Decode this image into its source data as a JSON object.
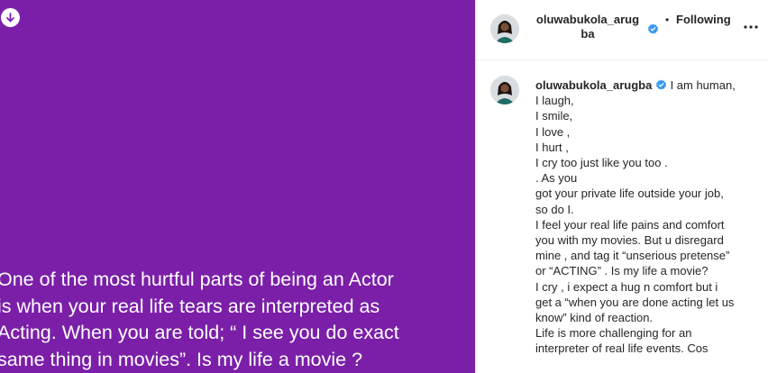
{
  "post": {
    "quote_lines": [
      "One of the most hurtful parts of being an Actor",
      "is when your real life tears are interpreted as",
      "Acting.  When you are told; “ I see you do exact",
      "same thing in movies”. Is my life a movie ?"
    ],
    "background_color": "#7b1fa8",
    "download_icon": "arrow-down-circle-icon"
  },
  "header": {
    "username_line1": "oluwabukola_arug",
    "username_line2": "ba",
    "separator": "•",
    "follow_label": "Following",
    "more_icon": "more-horizontal-icon",
    "verified_icon": "verified-badge-icon"
  },
  "caption": {
    "username": "oluwabukola_arugba",
    "first_text": "I am human,",
    "lines": [
      "I laugh,",
      "I smile,",
      "I love ,",
      "I hurt ,",
      "I cry too just like you too .",
      ". As you",
      "got your private life outside your job,",
      "so do I.",
      "I feel your real life pains and comfort",
      "you with my movies. But u disregard",
      "mine , and tag it “unserious pretense”",
      "or “ACTING” . Is my life a movie?",
      "I cry , i expect a hug n comfort but i",
      "get a “when you are done acting let us",
      "know” kind of reaction.",
      "Life is more challenging for an",
      "interpreter of real life events. Cos"
    ]
  },
  "colors": {
    "verified_blue": "#3897f0",
    "text": "#262626"
  }
}
